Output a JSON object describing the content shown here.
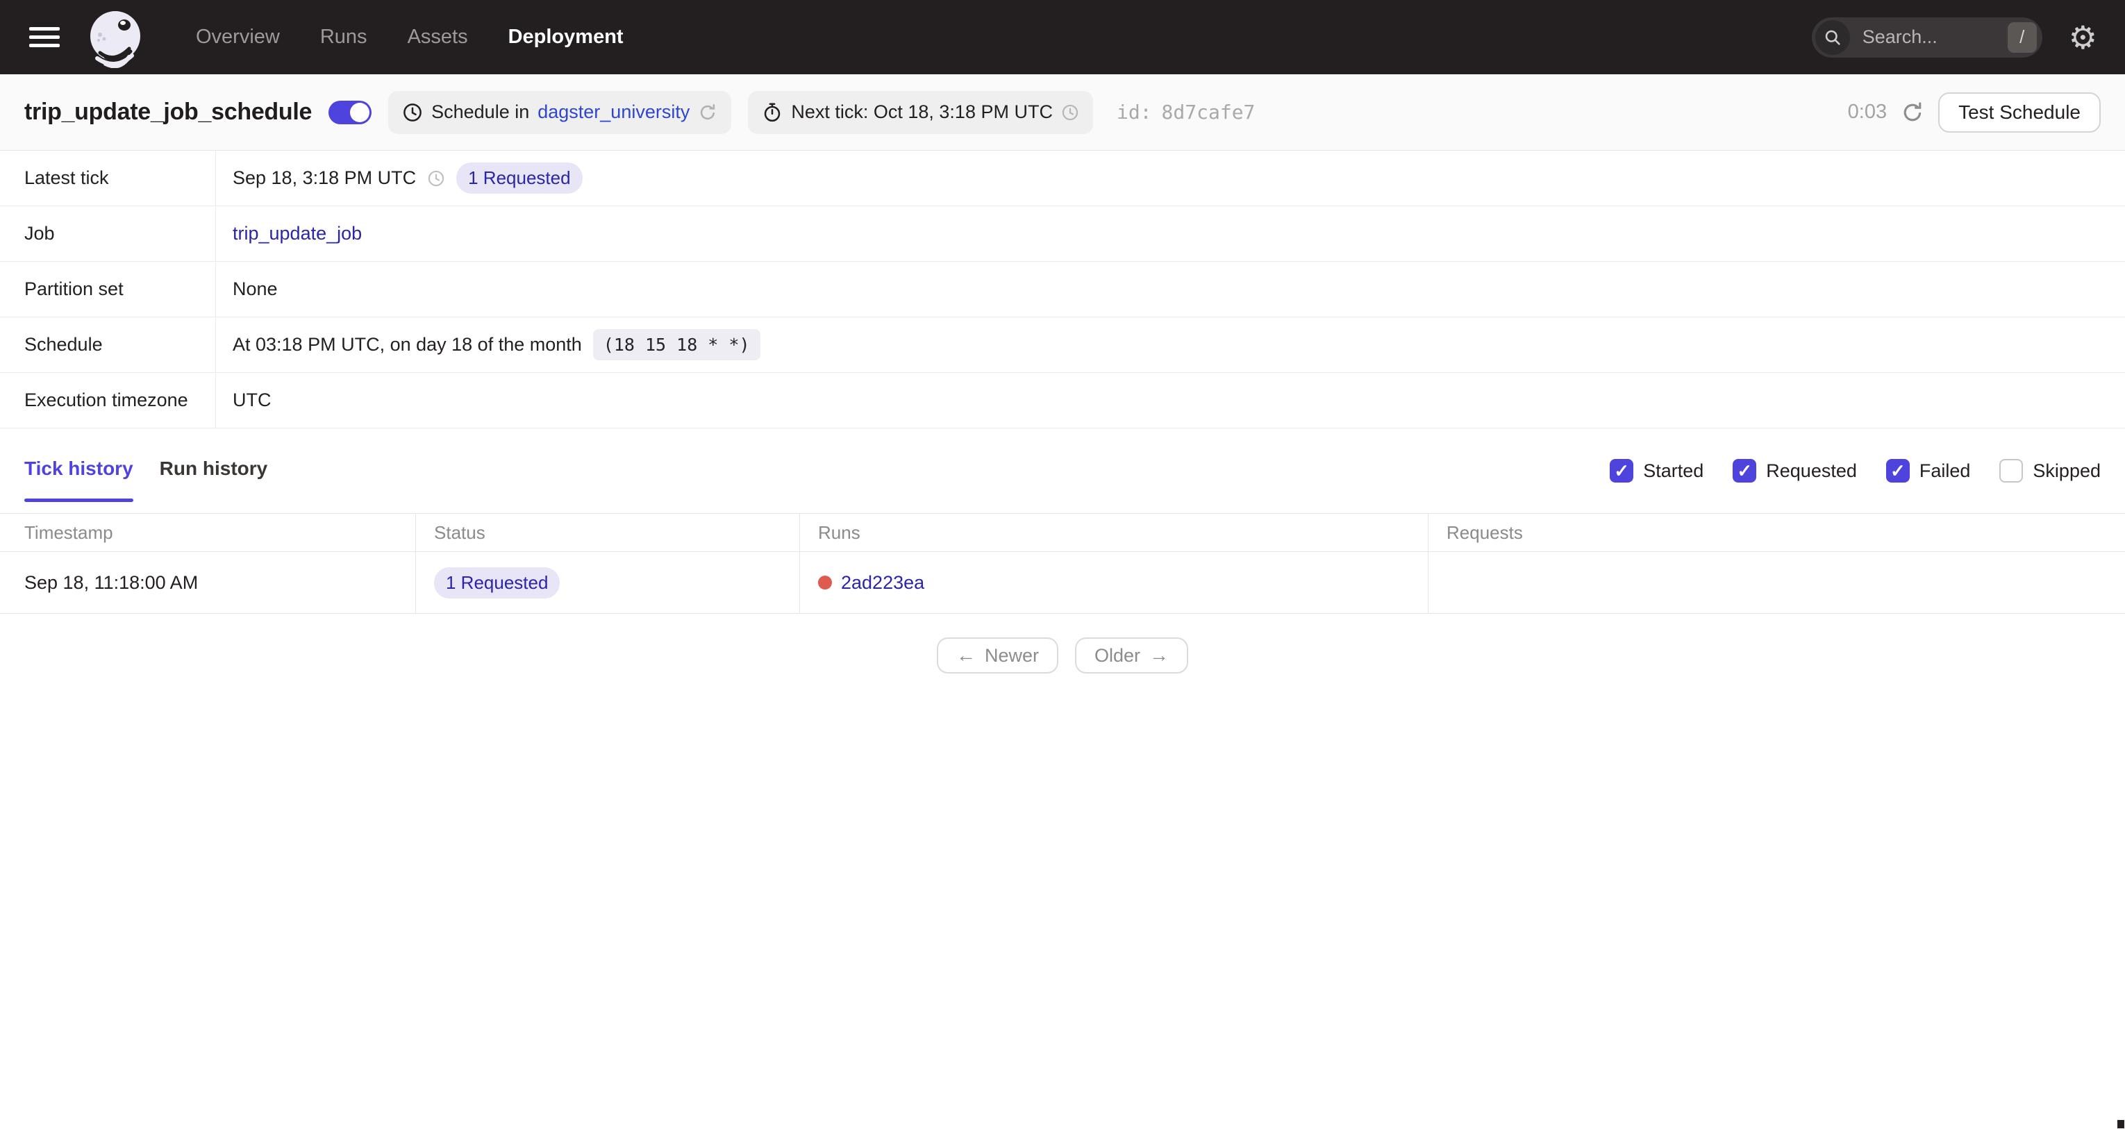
{
  "topnav": {
    "nav": [
      {
        "label": "Overview",
        "active": false
      },
      {
        "label": "Runs",
        "active": false
      },
      {
        "label": "Assets",
        "active": false
      },
      {
        "label": "Deployment",
        "active": true
      }
    ],
    "search": {
      "placeholder": "Search...",
      "shortcut": "/"
    }
  },
  "header": {
    "title": "trip_update_job_schedule",
    "toggle_on": true,
    "schedule_tag": {
      "prefix": "Schedule in",
      "link": "dagster_university"
    },
    "next_tick": "Next tick: Oct 18, 3:18 PM UTC",
    "id_label": "id:",
    "id_value": "8d7cafe7",
    "countdown": "0:03",
    "test_button": "Test Schedule"
  },
  "details": {
    "rows": [
      {
        "label": "Latest tick",
        "timestamp": "Sep 18, 3:18 PM UTC",
        "badge": "1 Requested"
      },
      {
        "label": "Job",
        "link": "trip_update_job"
      },
      {
        "label": "Partition set",
        "value": "None"
      },
      {
        "label": "Schedule",
        "value": "At 03:18 PM UTC, on day 18 of the month",
        "cron": "(18 15 18 * *)"
      },
      {
        "label": "Execution timezone",
        "value": "UTC"
      }
    ]
  },
  "tabs": [
    {
      "label": "Tick history",
      "active": true
    },
    {
      "label": "Run history",
      "active": false
    }
  ],
  "filters": [
    {
      "label": "Started",
      "checked": true
    },
    {
      "label": "Requested",
      "checked": true
    },
    {
      "label": "Failed",
      "checked": true
    },
    {
      "label": "Skipped",
      "checked": false
    }
  ],
  "tick_table": {
    "columns": [
      "Timestamp",
      "Status",
      "Runs",
      "Requests"
    ],
    "row": {
      "timestamp": "Sep 18, 11:18:00 AM",
      "status_badge": "1 Requested",
      "run_id": "2ad223ea",
      "requests": ""
    }
  },
  "pagination": {
    "newer": "Newer",
    "older": "Older",
    "newer_arrow": "←",
    "older_arrow": "→"
  },
  "colors": {
    "topnav_bg": "#231F20",
    "accent": "#4F43DD",
    "link": "#2B25A8",
    "repo_link": "#2E46CE",
    "badge_bg": "#E7E5F6",
    "run_dot": "#DE5B4F",
    "titlebar_bg": "#FAFAFA"
  },
  "check_glyph": "✓"
}
